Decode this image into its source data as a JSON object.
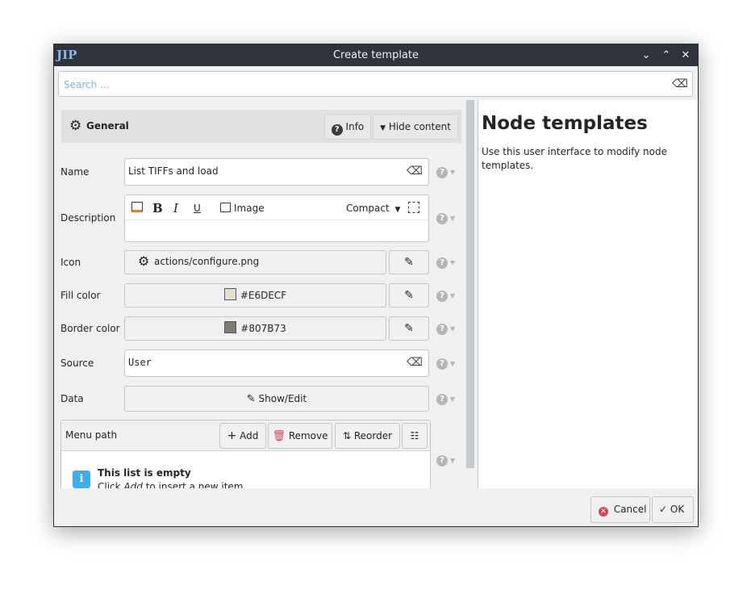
{
  "window": {
    "title": "Create template",
    "controls": [
      "minimize",
      "maximize",
      "close"
    ]
  },
  "search": {
    "placeholder": "Search ..."
  },
  "section": {
    "title": "General",
    "info_label": "Info",
    "hide_label": "Hide content"
  },
  "fields": {
    "name": {
      "label": "Name",
      "value": "List TIFFs and load"
    },
    "description": {
      "label": "Description",
      "toolbar": {
        "bold": "B",
        "italic": "I",
        "underline": "U",
        "image": "Image",
        "mode": "Compact"
      },
      "value": ""
    },
    "icon": {
      "label": "Icon",
      "value": "actions/configure.png"
    },
    "fill_color": {
      "label": "Fill color",
      "value": "#E6DECF"
    },
    "border_color": {
      "label": "Border color",
      "value": "#807B73"
    },
    "source": {
      "label": "Source",
      "value": "User"
    },
    "data": {
      "label": "Data",
      "button": "Show/Edit"
    }
  },
  "menu_path": {
    "label": "Menu path",
    "add": "Add",
    "remove": "Remove",
    "reorder": "Reorder",
    "empty_title": "This list is empty",
    "empty_prefix": "Click ",
    "empty_em": "Add",
    "empty_suffix": " to insert a new item."
  },
  "help_panel": {
    "title": "Node templates",
    "text": "Use this user interface to modify node templates."
  },
  "footer": {
    "cancel": "Cancel",
    "ok": "OK"
  },
  "colors": {
    "titlebar": "#2f343a",
    "fill_swatch": "#E6DECF",
    "border_swatch": "#807B73",
    "info_accent": "#3daee9",
    "remove_red": "#da4453",
    "placeholder": "#7fb4e0"
  }
}
